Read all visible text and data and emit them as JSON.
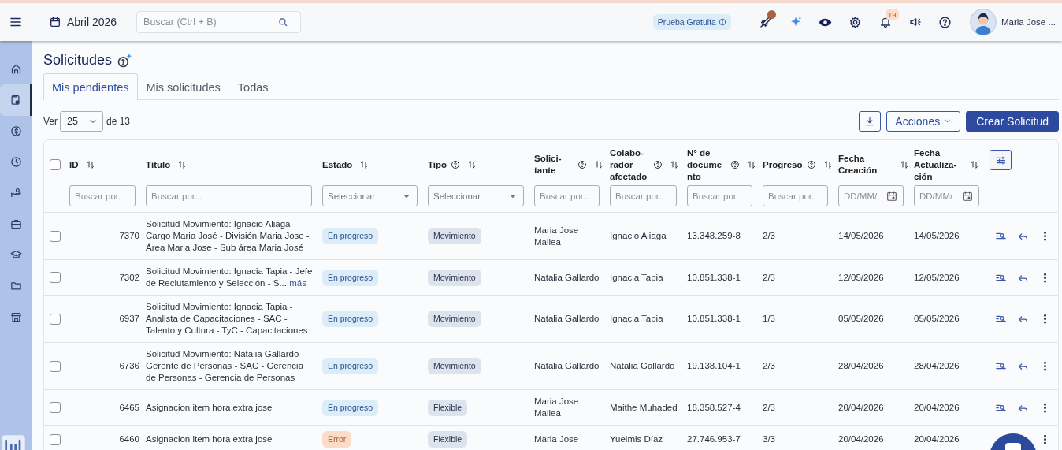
{
  "topbar": {
    "period": "Abril 2026",
    "search": {
      "placeholder": "Buscar (Ctrl + B)"
    },
    "trial_badge": "Prueba Gratuita",
    "rocket_alert": true,
    "notification_count": "19",
    "user_name": "Maria Jose ..."
  },
  "sidebar": {
    "items": [
      {
        "kind": "home",
        "selected": false
      },
      {
        "kind": "clipboard",
        "selected": true
      },
      {
        "kind": "money",
        "selected": false
      },
      {
        "kind": "clock",
        "selected": false
      },
      {
        "kind": "hand",
        "selected": false
      },
      {
        "kind": "briefcase",
        "selected": false
      },
      {
        "kind": "graduation",
        "selected": false
      },
      {
        "kind": "folder",
        "selected": false
      },
      {
        "kind": "store",
        "selected": false
      }
    ]
  },
  "page": {
    "title": "Solicitudes"
  },
  "tabs": [
    {
      "label": "Mis pendientes",
      "selected": true
    },
    {
      "label": "Mis solicitudes",
      "selected": false
    },
    {
      "label": "Todas",
      "selected": false
    }
  ],
  "toolbar": {
    "show_label": "Ver",
    "page_size": "25",
    "total_label": "de 13",
    "actions_button": "Acciones",
    "create_button": "Crear Solicitud"
  },
  "table": {
    "all_checked": false,
    "columns": [
      {
        "label": "ID",
        "help": false,
        "filter": {
          "kind": "text",
          "placeholder": "Buscar por."
        }
      },
      {
        "label": "Título",
        "help": false,
        "filter": {
          "kind": "text",
          "placeholder": "Buscar por..."
        }
      },
      {
        "label": "Estado",
        "help": false,
        "filter": {
          "kind": "select",
          "placeholder": "Seleccionar"
        }
      },
      {
        "label": "Tipo",
        "help": true,
        "filter": {
          "kind": "select",
          "placeholder": "Seleccionar"
        }
      },
      {
        "label": "Solici-tante",
        "help": true,
        "filter": {
          "kind": "text",
          "placeholder": "Buscar por.."
        }
      },
      {
        "label": "Colabo-rador afectado",
        "help": true,
        "filter": {
          "kind": "text",
          "placeholder": "Buscar por.."
        }
      },
      {
        "label": "N° de documento",
        "help": true,
        "filter": {
          "kind": "text",
          "placeholder": "Buscar por."
        }
      },
      {
        "label": "Progreso",
        "help": true,
        "filter": {
          "kind": "text",
          "placeholder": "Buscar por."
        }
      },
      {
        "label": "Fecha Creación",
        "help": false,
        "filter": {
          "kind": "date",
          "placeholder": "DD/MM/"
        }
      },
      {
        "label": "Fecha Actualiza-ción",
        "help": false,
        "filter": {
          "kind": "date",
          "placeholder": "DD/MM/"
        }
      }
    ],
    "rows": [
      {
        "checked": false,
        "id": "7370",
        "title": "Solicitud Movimiento: Ignacio Aliaga - Cargo Maria José - División Maria Jose - Área Maria Jose - Sub área Maria José",
        "status": {
          "label": "En progreso",
          "kind": "progress"
        },
        "type": "Movimiento",
        "requester": "Maria Jose Mallea",
        "collaborator": "Ignacio Aliaga",
        "document": "13.348.259-8",
        "progress": "2/3",
        "created": "14/05/2026",
        "updated": "14/05/2026"
      },
      {
        "checked": false,
        "id": "7302",
        "title": "Solicitud Movimiento: Ignacia Tapia - Jefe de Reclutamiento y Selección - S...",
        "more_link": "más",
        "status": {
          "label": "En progreso",
          "kind": "progress"
        },
        "type": "Movimiento",
        "requester": "Natalia Gallardo",
        "collaborator": "Ignacia Tapia",
        "document": "10.851.338-1",
        "progress": "2/3",
        "created": "12/05/2026",
        "updated": "12/05/2026"
      },
      {
        "checked": false,
        "id": "6937",
        "title": "Solicitud Movimiento: Ignacia Tapia - Analista de Capacitaciones - SAC - Talento y Cultura - TyC - Capacitaciones",
        "status": {
          "label": "En progreso",
          "kind": "progress"
        },
        "type": "Movimiento",
        "requester": "Natalia Gallardo",
        "collaborator": "Ignacia Tapia",
        "document": "10.851.338-1",
        "progress": "1/3",
        "created": "05/05/2026",
        "updated": "05/05/2026"
      },
      {
        "checked": false,
        "id": "6736",
        "title": "Solicitud Movimiento: Natalia Gallardo - Gerente de Personas - SAC - Gerencia de Personas - Gerencia de Personas",
        "status": {
          "label": "En progreso",
          "kind": "progress"
        },
        "type": "Movimiento",
        "requester": "Natalia Gallardo",
        "collaborator": "Natalia Gallardo",
        "document": "19.138.104-1",
        "progress": "2/3",
        "created": "28/04/2026",
        "updated": "28/04/2026"
      },
      {
        "checked": false,
        "id": "6465",
        "title": "Asignacion item hora extra jose",
        "status": {
          "label": "En progreso",
          "kind": "progress"
        },
        "type": "Flexible",
        "requester": "Maria Jose Mallea",
        "collaborator": "Maithe Muhaded",
        "document": "18.358.527-4",
        "progress": "2/3",
        "created": "20/04/2026",
        "updated": "20/04/2026"
      },
      {
        "checked": false,
        "id": "6460",
        "title": "Asignacion item hora extra jose",
        "status": {
          "label": "Error",
          "kind": "error"
        },
        "type": "Flexible",
        "requester": "Maria Jose",
        "collaborator": "Yuelmis Díaz",
        "document": "27.746.953-7",
        "progress": "3/3",
        "created": "20/04/2026",
        "updated": "20/04/2026"
      }
    ]
  }
}
